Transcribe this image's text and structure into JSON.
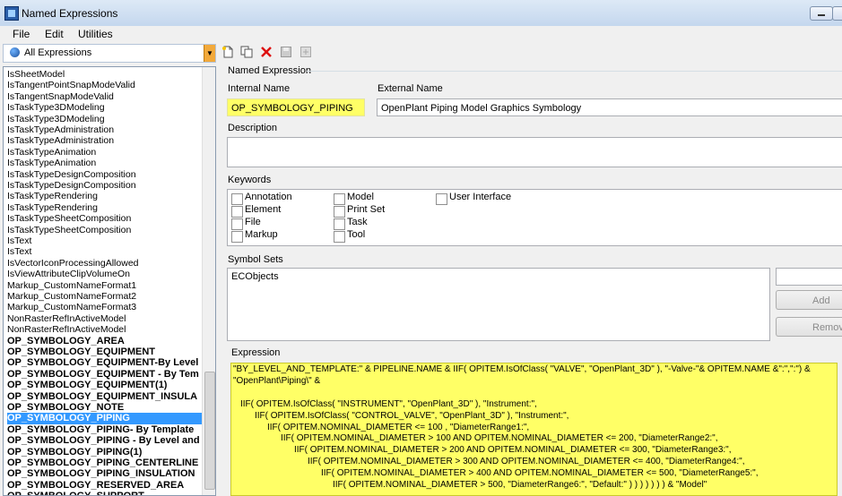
{
  "window": {
    "title": "Named Expressions"
  },
  "menu": [
    "File",
    "Edit",
    "Utilities"
  ],
  "toolbar": {
    "filter_value": "All Expressions"
  },
  "list": {
    "items": [
      {
        "label": "IsSheetModel",
        "bold": false,
        "selected": false
      },
      {
        "label": "IsTangentPointSnapModeValid",
        "bold": false,
        "selected": false
      },
      {
        "label": "IsTangentSnapModeValid",
        "bold": false,
        "selected": false
      },
      {
        "label": "IsTaskType3DModeling",
        "bold": false,
        "selected": false
      },
      {
        "label": "IsTaskType3DModeling",
        "bold": false,
        "selected": false
      },
      {
        "label": "IsTaskTypeAdministration",
        "bold": false,
        "selected": false
      },
      {
        "label": "IsTaskTypeAdministration",
        "bold": false,
        "selected": false
      },
      {
        "label": "IsTaskTypeAnimation",
        "bold": false,
        "selected": false
      },
      {
        "label": "IsTaskTypeAnimation",
        "bold": false,
        "selected": false
      },
      {
        "label": "IsTaskTypeDesignComposition",
        "bold": false,
        "selected": false
      },
      {
        "label": "IsTaskTypeDesignComposition",
        "bold": false,
        "selected": false
      },
      {
        "label": "IsTaskTypeRendering",
        "bold": false,
        "selected": false
      },
      {
        "label": "IsTaskTypeRendering",
        "bold": false,
        "selected": false
      },
      {
        "label": "IsTaskTypeSheetComposition",
        "bold": false,
        "selected": false
      },
      {
        "label": "IsTaskTypeSheetComposition",
        "bold": false,
        "selected": false
      },
      {
        "label": "IsText",
        "bold": false,
        "selected": false
      },
      {
        "label": "IsText",
        "bold": false,
        "selected": false
      },
      {
        "label": "IsVectorIconProcessingAllowed",
        "bold": false,
        "selected": false
      },
      {
        "label": "IsViewAttributeClipVolumeOn",
        "bold": false,
        "selected": false
      },
      {
        "label": "Markup_CustomNameFormat1",
        "bold": false,
        "selected": false
      },
      {
        "label": "Markup_CustomNameFormat2",
        "bold": false,
        "selected": false
      },
      {
        "label": "Markup_CustomNameFormat3",
        "bold": false,
        "selected": false
      },
      {
        "label": "NonRasterRefInActiveModel",
        "bold": false,
        "selected": false
      },
      {
        "label": "NonRasterRefInActiveModel",
        "bold": false,
        "selected": false
      },
      {
        "label": "OP_SYMBOLOGY_AREA",
        "bold": true,
        "selected": false
      },
      {
        "label": "OP_SYMBOLOGY_EQUIPMENT",
        "bold": true,
        "selected": false
      },
      {
        "label": "OP_SYMBOLOGY_EQUIPMENT-By Level",
        "bold": true,
        "selected": false
      },
      {
        "label": "OP_SYMBOLOGY_EQUIPMENT - By Tem",
        "bold": true,
        "selected": false
      },
      {
        "label": "OP_SYMBOLOGY_EQUIPMENT(1)",
        "bold": true,
        "selected": false
      },
      {
        "label": "OP_SYMBOLOGY_EQUIPMENT_INSULA",
        "bold": true,
        "selected": false
      },
      {
        "label": "OP_SYMBOLOGY_NOTE",
        "bold": true,
        "selected": false
      },
      {
        "label": "OP_SYMBOLOGY_PIPING",
        "bold": true,
        "selected": true
      },
      {
        "label": "OP_SYMBOLOGY_PIPING- By Template",
        "bold": true,
        "selected": false
      },
      {
        "label": "OP_SYMBOLOGY_PIPING - By Level and",
        "bold": true,
        "selected": false
      },
      {
        "label": "OP_SYMBOLOGY_PIPING(1)",
        "bold": true,
        "selected": false
      },
      {
        "label": "OP_SYMBOLOGY_PIPING_CENTERLINE",
        "bold": true,
        "selected": false
      },
      {
        "label": "OP_SYMBOLOGY_PIPING_INSULATION",
        "bold": true,
        "selected": false
      },
      {
        "label": "OP_SYMBOLOGY_RESERVED_AREA",
        "bold": true,
        "selected": false
      },
      {
        "label": "OP_SYMBOLOGY_SUPPORT",
        "bold": true,
        "selected": false
      }
    ]
  },
  "detail": {
    "group_label": "Named Expression",
    "internal_name_label": "Internal Name",
    "internal_name_value": "OP_SYMBOLOGY_PIPING",
    "external_name_label": "External Name",
    "external_name_value": "OpenPlant Piping Model Graphics Symbology",
    "description_label": "Description",
    "description_value": "",
    "keywords_label": "Keywords",
    "keywords": [
      {
        "label": "Annotation",
        "checked": false
      },
      {
        "label": "Element",
        "checked": false
      },
      {
        "label": "File",
        "checked": false
      },
      {
        "label": "Markup",
        "checked": false
      },
      {
        "label": "Model",
        "checked": false
      },
      {
        "label": "Print Set",
        "checked": false
      },
      {
        "label": "Task",
        "checked": false
      },
      {
        "label": "Tool",
        "checked": false
      },
      {
        "label": "User Interface",
        "checked": false
      }
    ],
    "symbol_sets_label": "Symbol Sets",
    "symbol_sets": [
      "ECObjects"
    ],
    "symbol_add_input": "",
    "add_button": "Add",
    "remove_button": "Remov",
    "expression_label": "Expression",
    "expression_lines": [
      "\"BY_LEVEL_AND_TEMPLATE:\" & PIPELINE.NAME &  IIF( OPITEM.IsOfClass( \"VALVE\", \"OpenPlant_3D\" ), \"-Valve-\"& OPITEM.NAME &\":\",\":\")  &",
      "\"OpenPlant\\Piping\\\" &",
      "",
      "IIF( OPITEM.IsOfClass( \"INSTRUMENT\", \"OpenPlant_3D\" ), \"Instrument:\",",
      "IIF( OPITEM.IsOfClass( \"CONTROL_VALVE\", \"OpenPlant_3D\" ), \"Instrument:\",",
      "IIF( OPITEM.NOMINAL_DIAMETER <= 100 , \"DiameterRange1:\",",
      "IIF( OPITEM.NOMINAL_DIAMETER > 100 AND OPITEM.NOMINAL_DIAMETER <= 200, \"DiameterRange2:\",",
      "IIF( OPITEM.NOMINAL_DIAMETER > 200 AND OPITEM.NOMINAL_DIAMETER <= 300, \"DiameterRange3:\",",
      "IIF( OPITEM.NOMINAL_DIAMETER > 300 AND OPITEM.NOMINAL_DIAMETER <= 400, \"DiameterRange4:\",",
      "IIF( OPITEM.NOMINAL_DIAMETER > 400 AND OPITEM.NOMINAL_DIAMETER <= 500, \"DiameterRange5:\",",
      "IIF( OPITEM.NOMINAL_DIAMETER > 500, \"DiameterRange6:\", \"Default:\" ) ) ) ) ) ) ) & \"Model\""
    ]
  },
  "colors": {
    "selection": "#3399ff",
    "highlight": "#ffff66",
    "accent": "#f2a93b"
  },
  "icons": [
    "app-icon",
    "globe-icon",
    "new-icon",
    "copy-icon",
    "delete-icon",
    "save-icon",
    "export-icon"
  ]
}
